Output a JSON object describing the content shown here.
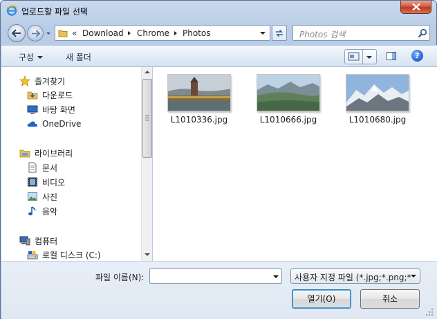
{
  "window": {
    "title": "업로드할 파일 선택",
    "colors": {
      "frame": "#b9cde6",
      "close": "#c2361c",
      "accent": "#3c7fb1"
    }
  },
  "address_bar": {
    "overflow": "«",
    "crumbs": [
      "Download",
      "Chrome",
      "Photos"
    ]
  },
  "search": {
    "placeholder": "Photos 검색"
  },
  "toolbar": {
    "organize_label": "구성",
    "new_folder_label": "새 폴더",
    "help_label": "?"
  },
  "nav": {
    "favorites": {
      "header": "즐겨찾기",
      "items": [
        {
          "label": "다운로드",
          "icon": "download-folder-icon"
        },
        {
          "label": "바탕 화면",
          "icon": "desktop-icon"
        },
        {
          "label": "OneDrive",
          "icon": "onedrive-cloud-icon"
        }
      ]
    },
    "libraries": {
      "header": "라이브러리",
      "items": [
        {
          "label": "문서",
          "icon": "document-icon"
        },
        {
          "label": "비디오",
          "icon": "video-icon"
        },
        {
          "label": "사진",
          "icon": "picture-icon"
        },
        {
          "label": "음악",
          "icon": "music-note-icon"
        }
      ]
    },
    "computer": {
      "header": "컴퓨터",
      "items": [
        {
          "label": "로컬 디스크 (C:)",
          "icon": "hard-disk-icon"
        }
      ]
    }
  },
  "files": [
    {
      "name": "L1010336.jpg",
      "thumb": "bridge-tower-photo"
    },
    {
      "name": "L1010666.jpg",
      "thumb": "mountain-valley-photo"
    },
    {
      "name": "L1010680.jpg",
      "thumb": "snowy-peaks-photo"
    }
  ],
  "bottom": {
    "filename_label": "파일 이름(N):",
    "filename_value": "",
    "filter_label": "사용자 지정 파일 (*.jpg;*.png;*",
    "open_label": "열기(O)",
    "cancel_label": "취소"
  }
}
